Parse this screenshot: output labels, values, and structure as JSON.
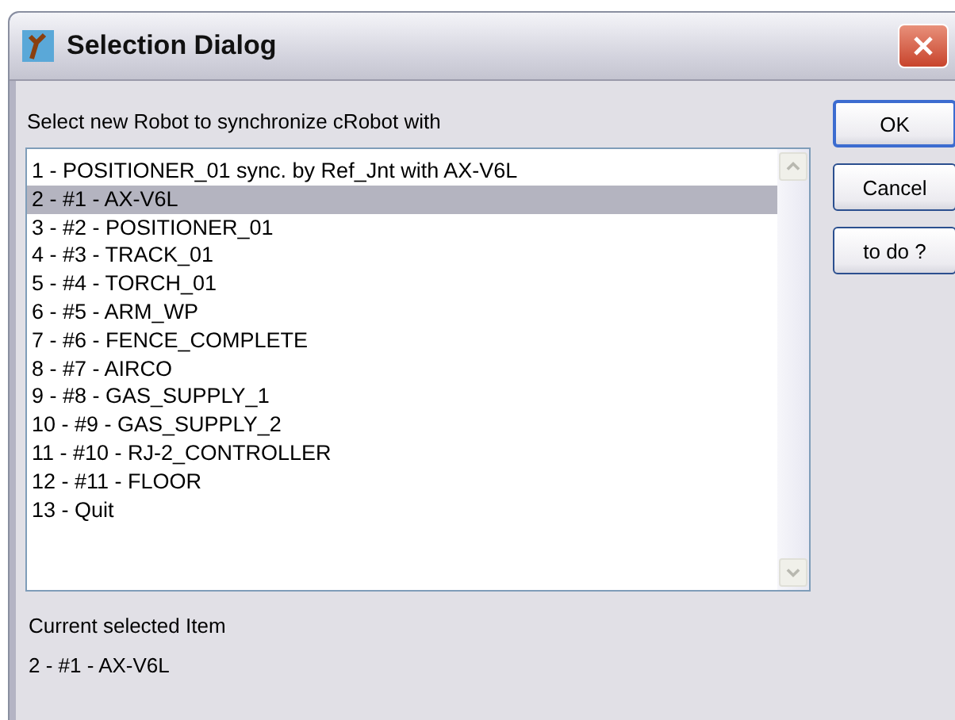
{
  "window": {
    "title": "Selection Dialog"
  },
  "prompt": "Select new Robot to synchronize cRobot with",
  "list": {
    "items": [
      {
        "label": "1 - POSITIONER_01 sync. by Ref_Jnt with AX-V6L",
        "selected": false
      },
      {
        "label": "2 - #1 - AX-V6L",
        "selected": true
      },
      {
        "label": "3 - #2 - POSITIONER_01",
        "selected": false
      },
      {
        "label": "4 - #3 - TRACK_01",
        "selected": false
      },
      {
        "label": "5 - #4 - TORCH_01",
        "selected": false
      },
      {
        "label": "6 - #5 - ARM_WP",
        "selected": false
      },
      {
        "label": "7 - #6 - FENCE_COMPLETE",
        "selected": false
      },
      {
        "label": "8 - #7 - AIRCO",
        "selected": false
      },
      {
        "label": "9 - #8 - GAS_SUPPLY_1",
        "selected": false
      },
      {
        "label": "10 - #9 - GAS_SUPPLY_2",
        "selected": false
      },
      {
        "label": "11 - #10 - RJ-2_CONTROLLER",
        "selected": false
      },
      {
        "label": "12 - #11 - FLOOR",
        "selected": false
      },
      {
        "label": "13 - Quit",
        "selected": false
      }
    ]
  },
  "buttons": [
    {
      "label": "OK",
      "selected": true
    },
    {
      "label": "Cancel",
      "selected": false
    },
    {
      "label": "to do ?",
      "selected": false
    }
  ],
  "current": {
    "label": "Current selected Item",
    "value": "2 - #1 - AX-V6L"
  }
}
